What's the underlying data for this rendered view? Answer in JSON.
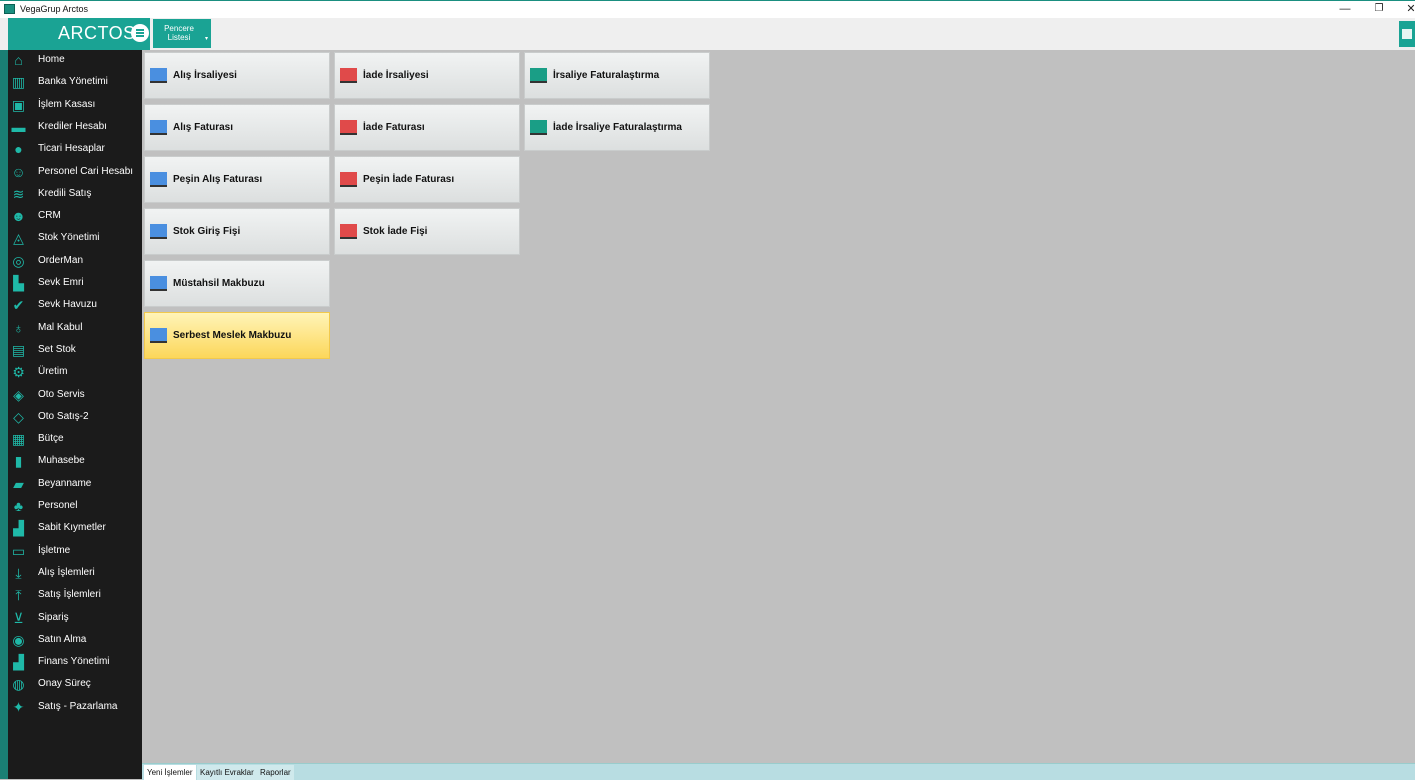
{
  "window": {
    "title": "VegaGrup Arctos",
    "icon": "app-icon",
    "min_glyph": "—",
    "max_glyph": "❐",
    "close_glyph": "✕"
  },
  "header": {
    "brand": "ARCTOS",
    "window_list_line1": "Pencere",
    "window_list_line2": "Listesi",
    "caret": "▾"
  },
  "colors": {
    "accent": "#1aa394",
    "sidebar_bg": "#1b1b1b",
    "icon_color": "#1fb9a8",
    "tile_blue": "#4a8fe0",
    "tile_red": "#e04a4a",
    "tile_teal": "#1a9e86",
    "selected_tile": "#fcd75a"
  },
  "sidebar": {
    "items": [
      {
        "label": "Home",
        "icon": "home-icon",
        "glyph": "⌂"
      },
      {
        "label": "Banka Yönetimi",
        "icon": "bank-chart-icon",
        "glyph": "▥"
      },
      {
        "label": "İşlem Kasası",
        "icon": "cash-register-icon",
        "glyph": "▣"
      },
      {
        "label": "Krediler Hesabı",
        "icon": "credit-card-icon",
        "glyph": "▬"
      },
      {
        "label": "Ticari Hesaplar",
        "icon": "person-icon",
        "glyph": "●"
      },
      {
        "label": "Personel Cari Hesabı",
        "icon": "people-icon",
        "glyph": "☺"
      },
      {
        "label": "Kredili Satış",
        "icon": "money-icon",
        "glyph": "≋"
      },
      {
        "label": "CRM",
        "icon": "customer-icon",
        "glyph": "☻"
      },
      {
        "label": "Stok Yönetimi",
        "icon": "stock-icon",
        "glyph": "◬"
      },
      {
        "label": "OrderMan",
        "icon": "orderman-icon",
        "glyph": "◎"
      },
      {
        "label": "Sevk Emri",
        "icon": "dispatch-icon",
        "glyph": "▙"
      },
      {
        "label": "Sevk Havuzu",
        "icon": "check-icon",
        "glyph": "✔"
      },
      {
        "label": "Mal Kabul",
        "icon": "goods-receipt-icon",
        "glyph": "♁"
      },
      {
        "label": "Set Stok",
        "icon": "set-stock-icon",
        "glyph": "▤"
      },
      {
        "label": "Üretim",
        "icon": "production-gear-icon",
        "glyph": "⚙"
      },
      {
        "label": "Oto Servis",
        "icon": "car-service-icon",
        "glyph": "◈"
      },
      {
        "label": "Oto Satış-2",
        "icon": "car-sales-icon",
        "glyph": "◇"
      },
      {
        "label": "Bütçe",
        "icon": "calculator-icon",
        "glyph": "▦"
      },
      {
        "label": "Muhasebe",
        "icon": "accounting-icon",
        "glyph": "▮"
      },
      {
        "label": "Beyanname",
        "icon": "briefcase-icon",
        "glyph": "▰"
      },
      {
        "label": "Personel",
        "icon": "staff-icon",
        "glyph": "♣"
      },
      {
        "label": "Sabit Kıymetler",
        "icon": "fixed-assets-icon",
        "glyph": "▟"
      },
      {
        "label": "İşletme",
        "icon": "monitor-icon",
        "glyph": "▭"
      },
      {
        "label": "Alış İşlemleri",
        "icon": "purchase-icon",
        "glyph": "⤓"
      },
      {
        "label": "Satış İşlemleri",
        "icon": "sales-icon",
        "glyph": "⤒"
      },
      {
        "label": "Sipariş",
        "icon": "cart-icon",
        "glyph": "⊻"
      },
      {
        "label": "Satın Alma",
        "icon": "handshake-icon",
        "glyph": "◉"
      },
      {
        "label": "Finans Yönetimi",
        "icon": "finance-chart-icon",
        "glyph": "▟"
      },
      {
        "label": "Onay Süreç",
        "icon": "approval-icon",
        "glyph": "◍"
      },
      {
        "label": "Satış - Pazarlama",
        "icon": "runner-icon",
        "glyph": "✦"
      }
    ]
  },
  "tiles": [
    {
      "label": "Alış İrsaliyesi",
      "color": "blue"
    },
    {
      "label": "Alış Faturası",
      "color": "blue"
    },
    {
      "label": "Peşin Alış Faturası",
      "color": "blue"
    },
    {
      "label": "Stok Giriş Fişi",
      "color": "blue"
    },
    {
      "label": "Müstahsil Makbuzu",
      "color": "blue"
    },
    {
      "label": "Serbest Meslek Makbuzu",
      "color": "blue",
      "selected": true
    },
    {
      "label": "İade İrsaliyesi",
      "color": "red"
    },
    {
      "label": "İade Faturası",
      "color": "red"
    },
    {
      "label": "Peşin İade Faturası",
      "color": "red"
    },
    {
      "label": "Stok İade Fişi",
      "color": "red"
    },
    {
      "label": "İrsaliye Faturalaştırma",
      "color": "teal"
    },
    {
      "label": "İade İrsaliye Faturalaştırma",
      "color": "teal"
    }
  ],
  "bottom_tabs": [
    {
      "label": "Yeni İşlemler",
      "active": true
    },
    {
      "label": "Kayıtlı Evraklar",
      "active": false
    },
    {
      "label": "Raporlar",
      "active": false
    }
  ]
}
